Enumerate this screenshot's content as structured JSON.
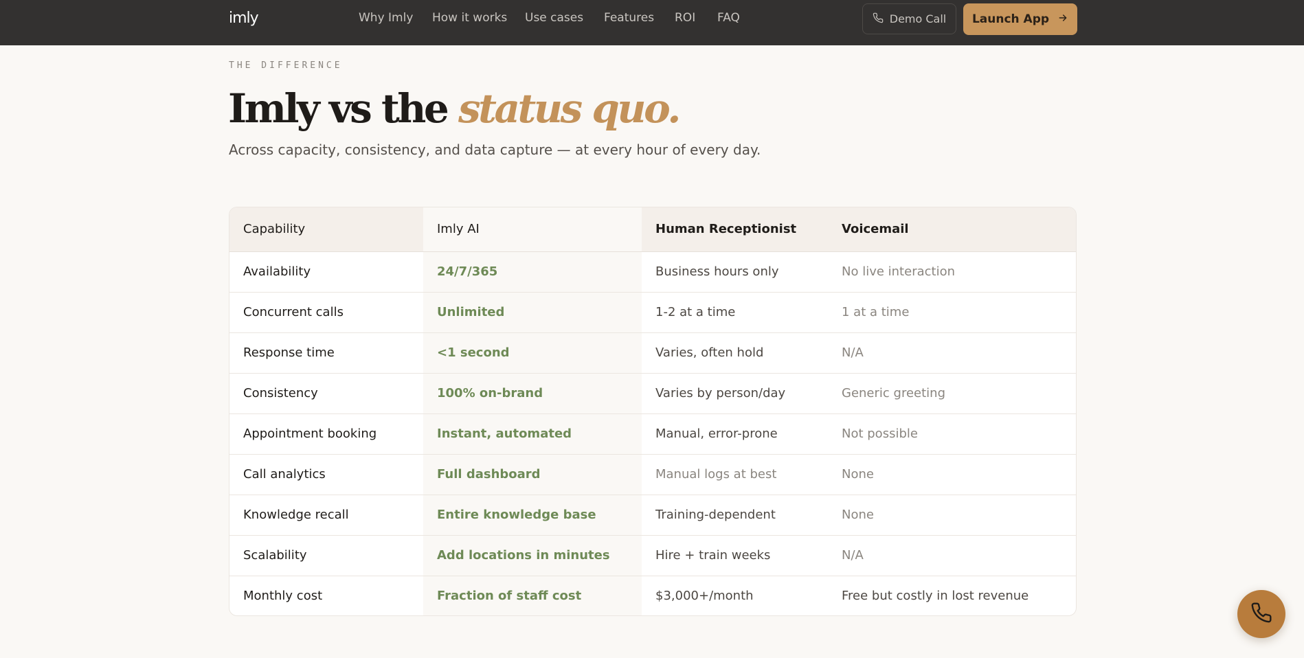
{
  "nav": {
    "logo": "imly",
    "links": [
      "Why Imly",
      "How it works",
      "Use cases",
      "Features",
      "ROI",
      "FAQ"
    ],
    "demo_label": "Demo Call",
    "launch_label": "Launch App"
  },
  "hero": {
    "eyebrow": "THE DIFFERENCE",
    "headline_main": "Imly vs the ",
    "headline_accent": "status quo.",
    "subhead": "Across capacity, consistency, and data capture — at every hour of every day."
  },
  "table": {
    "headers": [
      "Capability",
      "Imly AI",
      "Human Receptionist",
      "Voicemail"
    ],
    "rows": [
      [
        "Availability",
        "24/7/365",
        "Business hours only",
        "No live interaction"
      ],
      [
        "Concurrent calls",
        "Unlimited",
        "1-2 at a time",
        "1 at a time"
      ],
      [
        "Response time",
        "<1 second",
        "Varies, often hold",
        "N/A"
      ],
      [
        "Consistency",
        "100% on-brand",
        "Varies by person/day",
        "Generic greeting"
      ],
      [
        "Appointment booking",
        "Instant, automated",
        "Manual, error-prone",
        "Not possible"
      ],
      [
        "Call analytics",
        "Full dashboard",
        "Manual logs at best",
        "None"
      ],
      [
        "Knowledge recall",
        "Entire knowledge base",
        "Training-dependent",
        "None"
      ],
      [
        "Scalability",
        "Add locations in minutes",
        "Hire + train weeks",
        "N/A"
      ],
      [
        "Monthly cost",
        "Fraction of staff cost",
        "$3,000+/month",
        "Free but costly in lost revenue"
      ]
    ]
  },
  "colors": {
    "nav_bg": "#333130",
    "accent_gold": "#c8965c",
    "imly_green": "#6e8a56",
    "fab_bg": "#b87c3c"
  },
  "icons": {
    "demo": "phone-outline-icon",
    "launch": "arrow-right-icon",
    "fab": "phone-icon"
  }
}
